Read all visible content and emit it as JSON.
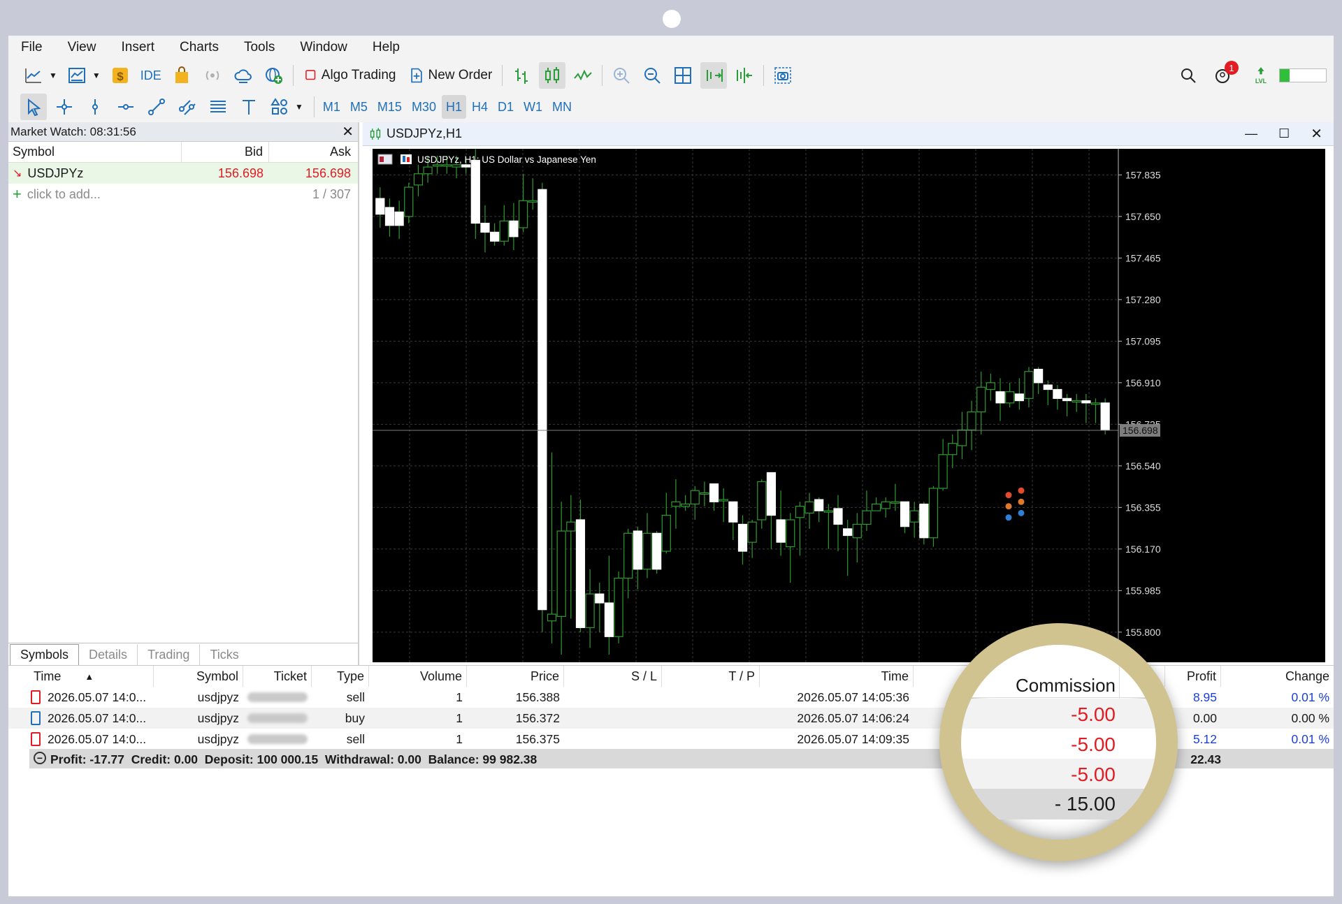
{
  "menu": [
    "File",
    "View",
    "Insert",
    "Charts",
    "Tools",
    "Window",
    "Help"
  ],
  "toolbar": {
    "ide_label": "IDE",
    "algo_trading_label": "Algo Trading",
    "new_order_label": "New Order",
    "notification_count": "1",
    "level_icon_label": "LVL"
  },
  "timeframes": [
    "M1",
    "M5",
    "M15",
    "M30",
    "H1",
    "H4",
    "D1",
    "W1",
    "MN"
  ],
  "active_timeframe": "H1",
  "market_watch": {
    "title": "Market Watch: 08:31:56",
    "columns": [
      "Symbol",
      "Bid",
      "Ask"
    ],
    "rows": [
      {
        "symbol": "USDJPYz",
        "bid": "156.698",
        "ask": "156.698"
      }
    ],
    "add_placeholder": "click to add...",
    "count": "1 / 307",
    "tabs": [
      "Symbols",
      "Details",
      "Trading",
      "Ticks"
    ],
    "active_tab": "Symbols"
  },
  "chart_window": {
    "title": "USDJPYz,H1",
    "subtitle": "USDJPYz, H1:  US Dollar vs Japanese Yen",
    "current_price": "156.698"
  },
  "chart_data": {
    "type": "candlestick",
    "symbol": "USDJPYz",
    "timeframe": "H1",
    "y_ticks": [
      "157.835",
      "157.650",
      "157.465",
      "157.280",
      "157.095",
      "156.910",
      "156.725",
      "156.540",
      "156.355",
      "156.170",
      "155.985",
      "155.800"
    ],
    "ylim": [
      155.7,
      157.92
    ],
    "current_price": 156.698,
    "candles": [
      [
        157.73,
        157.78,
        157.6,
        157.66
      ],
      [
        157.69,
        157.73,
        157.56,
        157.61
      ],
      [
        157.67,
        157.72,
        157.55,
        157.61
      ],
      [
        157.65,
        157.8,
        157.62,
        157.78
      ],
      [
        157.79,
        157.88,
        157.74,
        157.84
      ],
      [
        157.84,
        157.92,
        157.8,
        157.87
      ],
      [
        157.88,
        157.92,
        157.84,
        157.88
      ],
      [
        157.88,
        157.92,
        157.84,
        157.88
      ],
      [
        157.87,
        157.92,
        157.82,
        157.88
      ],
      [
        157.88,
        157.9,
        157.84,
        157.87
      ],
      [
        157.9,
        157.95,
        157.55,
        157.62
      ],
      [
        157.62,
        157.7,
        157.49,
        157.58
      ],
      [
        157.58,
        157.62,
        157.52,
        157.54
      ],
      [
        157.54,
        157.7,
        157.52,
        157.63
      ],
      [
        157.63,
        157.71,
        157.5,
        157.56
      ],
      [
        157.6,
        157.84,
        157.58,
        157.72
      ],
      [
        157.72,
        157.82,
        157.68,
        157.72
      ],
      [
        157.77,
        157.8,
        155.8,
        155.9
      ],
      [
        155.85,
        156.6,
        155.75,
        155.88
      ],
      [
        155.87,
        156.38,
        155.7,
        156.25
      ],
      [
        156.25,
        156.41,
        155.86,
        156.29
      ],
      [
        156.3,
        156.39,
        155.8,
        155.82
      ],
      [
        155.82,
        156.08,
        155.73,
        155.97
      ],
      [
        155.97,
        156.02,
        155.8,
        155.93
      ],
      [
        155.93,
        156.14,
        155.7,
        155.78
      ],
      [
        155.78,
        156.07,
        155.75,
        156.04
      ],
      [
        156.04,
        156.26,
        155.95,
        156.24
      ],
      [
        156.25,
        156.27,
        155.99,
        156.08
      ],
      [
        156.08,
        156.33,
        156.04,
        156.24
      ],
      [
        156.24,
        156.25,
        156.06,
        156.08
      ],
      [
        156.16,
        156.42,
        156.15,
        156.32
      ],
      [
        156.36,
        156.48,
        156.26,
        156.38
      ],
      [
        156.36,
        156.41,
        156.34,
        156.37
      ],
      [
        156.37,
        156.45,
        156.3,
        156.43
      ],
      [
        156.42,
        156.47,
        156.36,
        156.42
      ],
      [
        156.46,
        156.46,
        156.34,
        156.38
      ],
      [
        156.39,
        156.44,
        156.29,
        156.39
      ],
      [
        156.38,
        156.38,
        156.21,
        156.29
      ],
      [
        156.28,
        156.32,
        156.1,
        156.16
      ],
      [
        156.2,
        156.3,
        156.13,
        156.29
      ],
      [
        156.3,
        156.48,
        156.26,
        156.47
      ],
      [
        156.51,
        156.51,
        156.17,
        156.32
      ],
      [
        156.3,
        156.43,
        156.14,
        156.2
      ],
      [
        156.18,
        156.33,
        156.02,
        156.3
      ],
      [
        156.31,
        156.38,
        156.14,
        156.36
      ],
      [
        156.33,
        156.42,
        156.26,
        156.38
      ],
      [
        156.39,
        156.4,
        156.29,
        156.34
      ],
      [
        156.34,
        156.37,
        156.17,
        156.34
      ],
      [
        156.35,
        156.41,
        156.16,
        156.28
      ],
      [
        156.26,
        156.3,
        156.05,
        156.23
      ],
      [
        156.22,
        156.33,
        156.11,
        156.28
      ],
      [
        156.28,
        156.43,
        156.25,
        156.34
      ],
      [
        156.34,
        156.4,
        156.34,
        156.37
      ],
      [
        156.35,
        156.4,
        156.31,
        156.38
      ],
      [
        156.38,
        156.46,
        156.34,
        156.38
      ],
      [
        156.38,
        156.38,
        156.24,
        156.27
      ],
      [
        156.29,
        156.38,
        156.22,
        156.34
      ],
      [
        156.37,
        156.38,
        156.19,
        156.22
      ],
      [
        156.22,
        156.45,
        156.18,
        156.44
      ],
      [
        156.44,
        156.66,
        156.43,
        156.59
      ],
      [
        156.59,
        156.68,
        156.53,
        156.64
      ],
      [
        156.63,
        156.78,
        156.57,
        156.7
      ],
      [
        156.7,
        156.83,
        156.61,
        156.78
      ],
      [
        156.78,
        156.96,
        156.68,
        156.89
      ],
      [
        156.88,
        156.95,
        156.83,
        156.91
      ],
      [
        156.87,
        156.93,
        156.74,
        156.82
      ],
      [
        156.82,
        156.91,
        156.8,
        156.87
      ],
      [
        156.86,
        156.93,
        156.79,
        156.83
      ],
      [
        156.84,
        156.98,
        156.8,
        156.96
      ],
      [
        156.97,
        156.98,
        156.86,
        156.91
      ],
      [
        156.9,
        156.92,
        156.81,
        156.88
      ],
      [
        156.88,
        156.9,
        156.79,
        156.84
      ],
      [
        156.84,
        156.86,
        156.76,
        156.83
      ],
      [
        156.83,
        156.86,
        156.78,
        156.83
      ],
      [
        156.83,
        156.86,
        156.73,
        156.82
      ],
      [
        156.82,
        156.84,
        156.73,
        156.82
      ],
      [
        156.82,
        156.84,
        156.68,
        156.7
      ]
    ]
  },
  "toolbox": {
    "columns": [
      "Time",
      "Symbol",
      "Ticket",
      "Type",
      "Volume",
      "Price",
      "S / L",
      "T / P",
      "Time",
      "",
      "Commission",
      "",
      "Profit",
      "Change"
    ],
    "rows": [
      {
        "time": "2026.05.07 14:0...",
        "symbol": "usdjpyz",
        "type": "sell",
        "volume": "1",
        "price": "156.388",
        "close_time": "2026.05.07 14:05:36",
        "commission": "-5.00",
        "profit": "8.95",
        "change": "0.01 %"
      },
      {
        "time": "2026.05.07 14:0...",
        "symbol": "usdjpyz",
        "type": "buy",
        "volume": "1",
        "price": "156.372",
        "close_time": "2026.05.07 14:06:24",
        "commission": "-5.00",
        "profit": "0.00",
        "change": "0.00 %"
      },
      {
        "time": "2026.05.07 14:0...",
        "symbol": "usdjpyz",
        "type": "sell",
        "volume": "1",
        "price": "156.375",
        "close_time": "2026.05.07 14:09:35",
        "commission": "-5.00",
        "profit": "5.12",
        "change": "0.01 %"
      }
    ],
    "summary": "Profit: -17.77  Credit: 0.00  Deposit: 100 000.15  Withdrawal: 0.00  Balance: 99 982.38",
    "total_commission": "- 15.00",
    "total_profit": "22.43"
  },
  "colors": {
    "accent": "#1f6fbd",
    "negative": "#e31c23",
    "positive_link": "#1a3fd6",
    "candle_up": "#2e8b2e",
    "magnifier_ring": "#d0c38f"
  }
}
